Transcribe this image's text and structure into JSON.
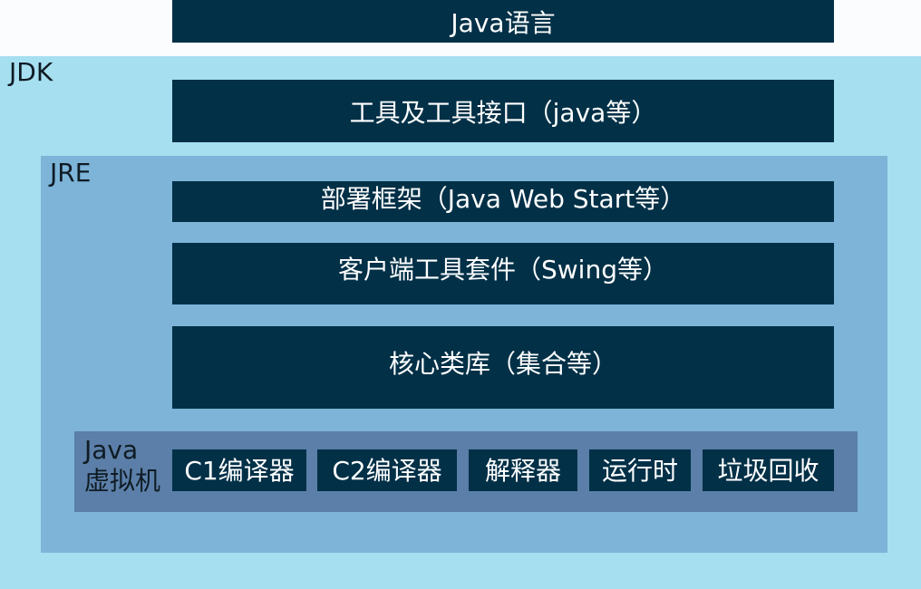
{
  "top": {
    "java_language": "Java语言"
  },
  "jdk": {
    "label": "JDK",
    "tools": "工具及工具接口（java等）"
  },
  "jre": {
    "label": "JRE",
    "deploy": "部署框架（Java Web Start等）",
    "client": "客户端工具套件（Swing等）",
    "core": "核心类库（集合等）"
  },
  "jvm": {
    "label_line1": "Java",
    "label_line2": "虚拟机",
    "components": [
      "C1编译器",
      "C2编译器",
      "解释器",
      "运行时",
      "垃圾回收"
    ]
  },
  "colors": {
    "box": "#013047",
    "jdk_bg": "#a6dff0",
    "jre_bg": "#7db4d8",
    "jvm_bg": "#5b7fa8",
    "top_bg": "#fafcfe"
  }
}
